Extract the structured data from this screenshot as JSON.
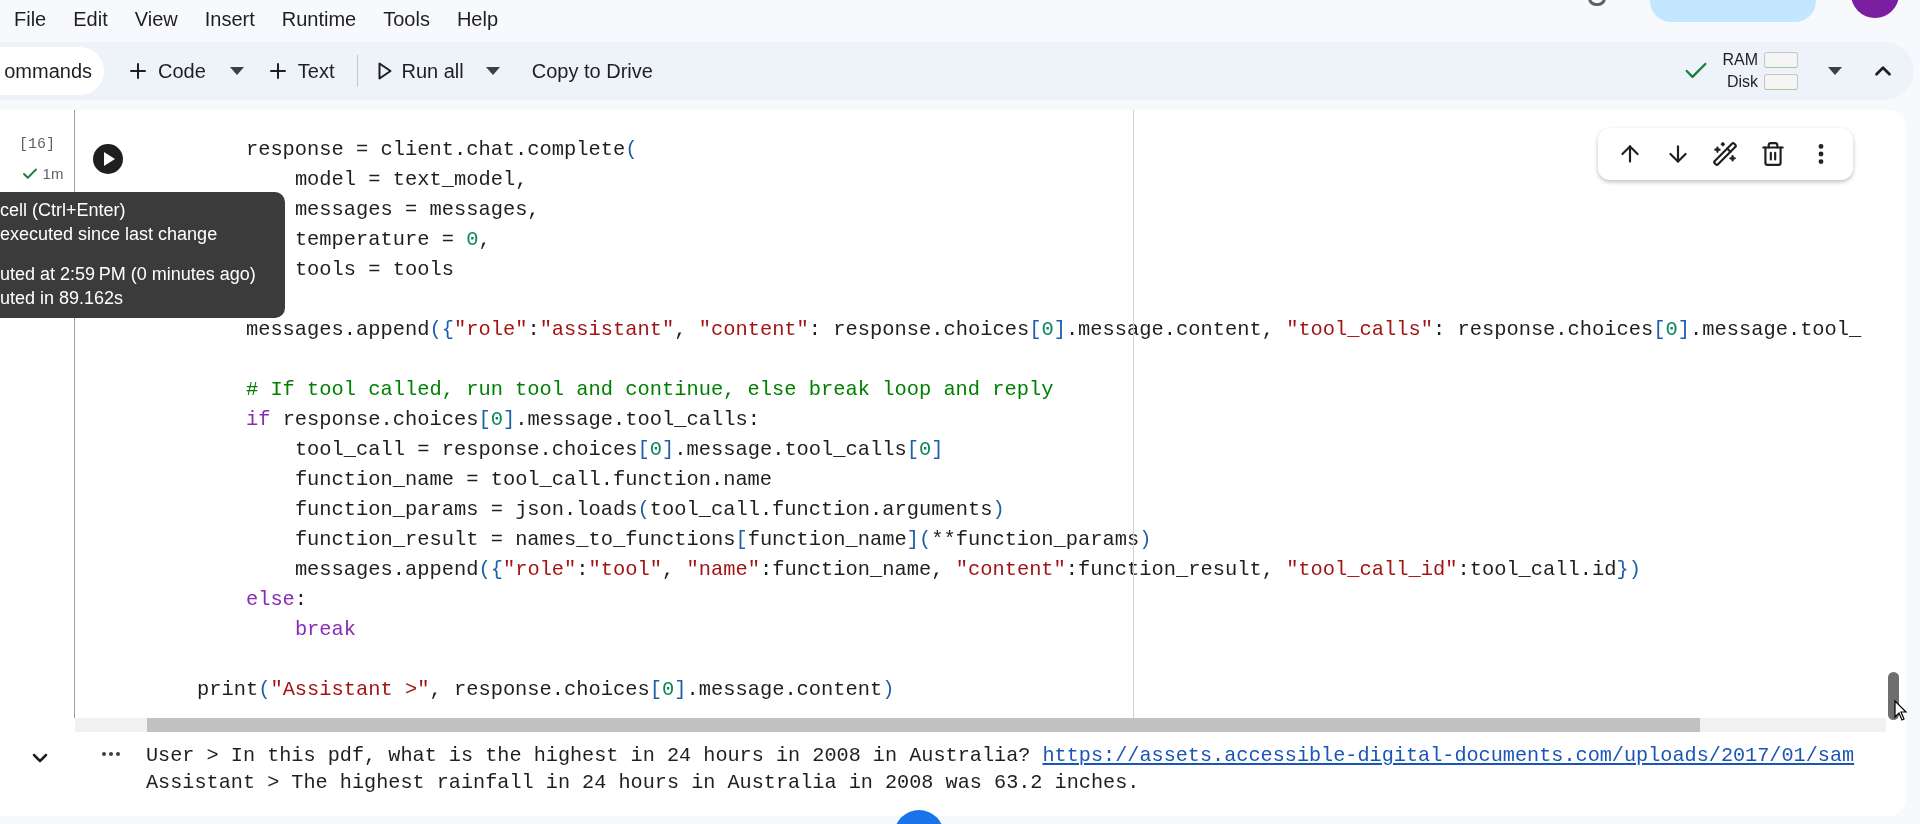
{
  "menu": [
    "File",
    "Edit",
    "View",
    "Insert",
    "Runtime",
    "Tools",
    "Help"
  ],
  "toolbar": [
    {
      "kind": "pill",
      "label": "ommands",
      "dropdown": false
    },
    {
      "kind": "add",
      "label": "Code",
      "dropdown": true
    },
    {
      "kind": "add",
      "label": "Text",
      "dropdown": false
    },
    {
      "kind": "run",
      "label": "Run all",
      "dropdown": true
    },
    {
      "kind": "plain",
      "label": "Copy to Drive",
      "dropdown": false
    }
  ],
  "status": {
    "connected": true,
    "ram_label": "RAM",
    "disk_label": "Disk"
  },
  "cell": {
    "execution_count": "[16]",
    "elapsed": "1m",
    "succeeded": true,
    "lines": [
      {
        "kind": "code",
        "text": "        response = client.chat.complete("
      },
      {
        "kind": "code",
        "text": "            model = text_model,"
      },
      {
        "kind": "code",
        "text": "            messages = messages,"
      },
      {
        "kind": "code",
        "text": "            temperature = 0,"
      },
      {
        "kind": "code",
        "text": "            tools = tools"
      },
      {
        "kind": "blank"
      },
      {
        "kind": "code",
        "text": "        messages.append({\"role\":\"assistant\", \"content\": response.choices[0].message.content, \"tool_calls\": response.choices[0].message.tool_"
      },
      {
        "kind": "blank"
      },
      {
        "kind": "comment",
        "text": "        # If tool called, run tool and continue, else break loop and reply"
      },
      {
        "kind": "keyword",
        "text": "        if response.choices[0].message.tool_calls:"
      },
      {
        "kind": "code",
        "text": "            tool_call = response.choices[0].message.tool_calls[0]"
      },
      {
        "kind": "code",
        "text": "            function_name = tool_call.function.name"
      },
      {
        "kind": "code",
        "text": "            function_params = json.loads(tool_call.function.arguments)"
      },
      {
        "kind": "code",
        "text": "            function_result = names_to_functions[function_name](**function_params)"
      },
      {
        "kind": "code",
        "text": "            messages.append({\"role\":\"tool\", \"name\":function_name, \"content\":function_result, \"tool_call_id\":tool_call.id})"
      },
      {
        "kind": "keyword",
        "text": "        else:"
      },
      {
        "kind": "keyword",
        "text": "            break"
      },
      {
        "kind": "blank"
      },
      {
        "kind": "code",
        "text": "    print(\"Assistant >\", response.choices[0].message.content)"
      }
    ],
    "output": [
      {
        "text": "User > In this pdf, what is the highest in 24 hours in 2008 in Australia? ",
        "link": "https://assets.accessible-digital-documents.com/uploads/2017/01/sam"
      },
      {
        "text": "Assistant > The highest rainfall in 24 hours in Australia in 2008 was 63.2 inches."
      }
    ]
  },
  "tooltip": {
    "groups": [
      [
        "cell (Ctrl+Enter)",
        "executed since last change"
      ],
      [
        "uted at 2:59 PM (0 minutes ago)",
        "uted in 89.162s"
      ]
    ]
  }
}
